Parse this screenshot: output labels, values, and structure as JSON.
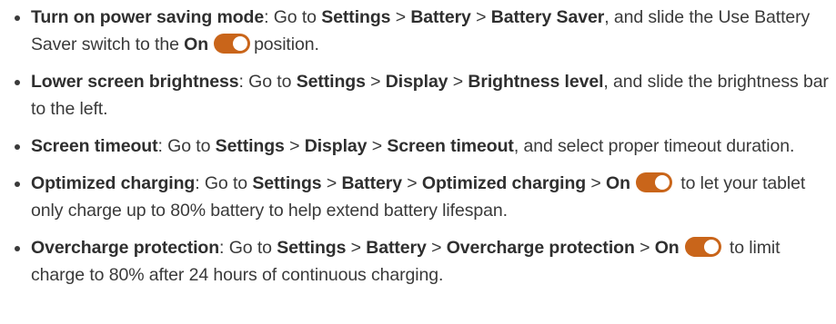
{
  "accent_color": "#c9651a",
  "tips": [
    {
      "title": "Turn on power saving mode",
      "intro": "Go to",
      "path": [
        "Settings",
        "Battery",
        "Battery Saver"
      ],
      "tail": ", and slide the Use Battery Saver switch to the",
      "switch_label": "On",
      "tail2": "position."
    },
    {
      "title": "Lower screen brightness",
      "intro": "Go to",
      "path": [
        "Settings",
        "Display",
        "Brightness level"
      ],
      "tail": ", and slide the brightness bar to the left."
    },
    {
      "title": "Screen timeout",
      "intro": "Go to",
      "path": [
        "Settings",
        "Display",
        "Screen timeout"
      ],
      "tail": ", and select proper timeout duration."
    },
    {
      "title": "Optimized charging",
      "intro": "Go to",
      "path": [
        "Settings",
        "Battery",
        "Optimized charging"
      ],
      "switch_label": "On",
      "tail": "to let your tablet only charge up to 80% battery to help extend battery lifespan."
    },
    {
      "title": "Overcharge protection",
      "intro": "Go to",
      "path": [
        "Settings",
        "Battery",
        "Overcharge protection"
      ],
      "switch_label": "On",
      "tail": "to limit charge to 80% after 24 hours of continuous charging."
    }
  ]
}
